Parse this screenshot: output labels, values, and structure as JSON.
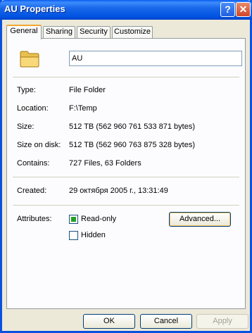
{
  "window": {
    "title": "AU Properties",
    "help_label": "?",
    "close_label": "✕"
  },
  "tabs": [
    {
      "label": "General",
      "active": true
    },
    {
      "label": "Sharing",
      "active": false
    },
    {
      "label": "Security",
      "active": false
    },
    {
      "label": "Customize",
      "active": false
    }
  ],
  "general": {
    "icon": "folder-icon",
    "name_value": "AU",
    "fields": [
      {
        "label": "Type:",
        "value": "File Folder"
      },
      {
        "label": "Location:",
        "value": "F:\\Temp"
      },
      {
        "label": "Size:",
        "value": "512 TB (562 960 761 533 871 bytes)"
      },
      {
        "label": "Size on disk:",
        "value": "512 TB (562 960 763 875 328 bytes)"
      },
      {
        "label": "Contains:",
        "value": "727 Files, 63 Folders"
      }
    ],
    "created_label": "Created:",
    "created_value": "29 октября 2005 г., 13:31:49",
    "attributes_label": "Attributes:",
    "readonly_label": "Read-only",
    "readonly_checked": true,
    "hidden_label": "Hidden",
    "hidden_checked": false,
    "advanced_label": "Advanced..."
  },
  "buttons": {
    "ok": "OK",
    "cancel": "Cancel",
    "apply": "Apply",
    "apply_enabled": false
  }
}
